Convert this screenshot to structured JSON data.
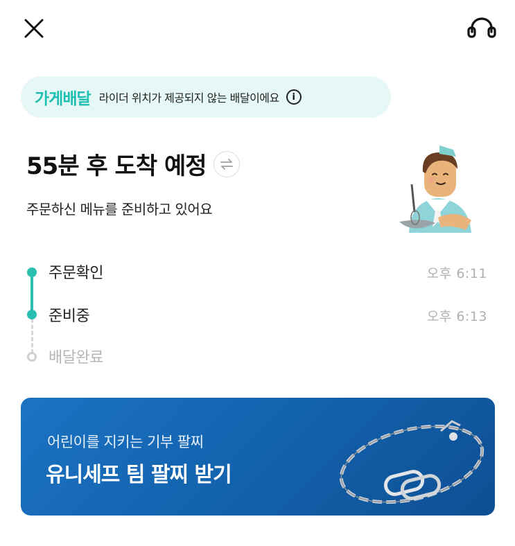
{
  "header": {
    "close_icon": "close-icon",
    "support_icon": "headset-icon"
  },
  "delivery_info": {
    "tag": "가게배달",
    "message": "라이더 위치가 제공되지 않는 배달이에요",
    "info_icon": "info-icon",
    "info_glyph": "i"
  },
  "eta": {
    "title": "55분 후 도착 예정",
    "subtitle": "주문하신 메뉴를 준비하고 있어요",
    "swap_icon": "swap-icon"
  },
  "timeline": {
    "steps": [
      {
        "label": "주문확인",
        "time": "오후 6:11",
        "status": "done"
      },
      {
        "label": "준비중",
        "time": "오후 6:13",
        "status": "done"
      },
      {
        "label": "배달완료",
        "time": "",
        "status": "pending"
      }
    ]
  },
  "banner": {
    "subtitle": "어린이를 지키는 기부 팔찌",
    "title": "유니세프 팀 팔찌 받기"
  },
  "colors": {
    "accent": "#2bbfb2",
    "pill_bg": "#e6f8f6",
    "banner_bg": "#1362ad"
  }
}
